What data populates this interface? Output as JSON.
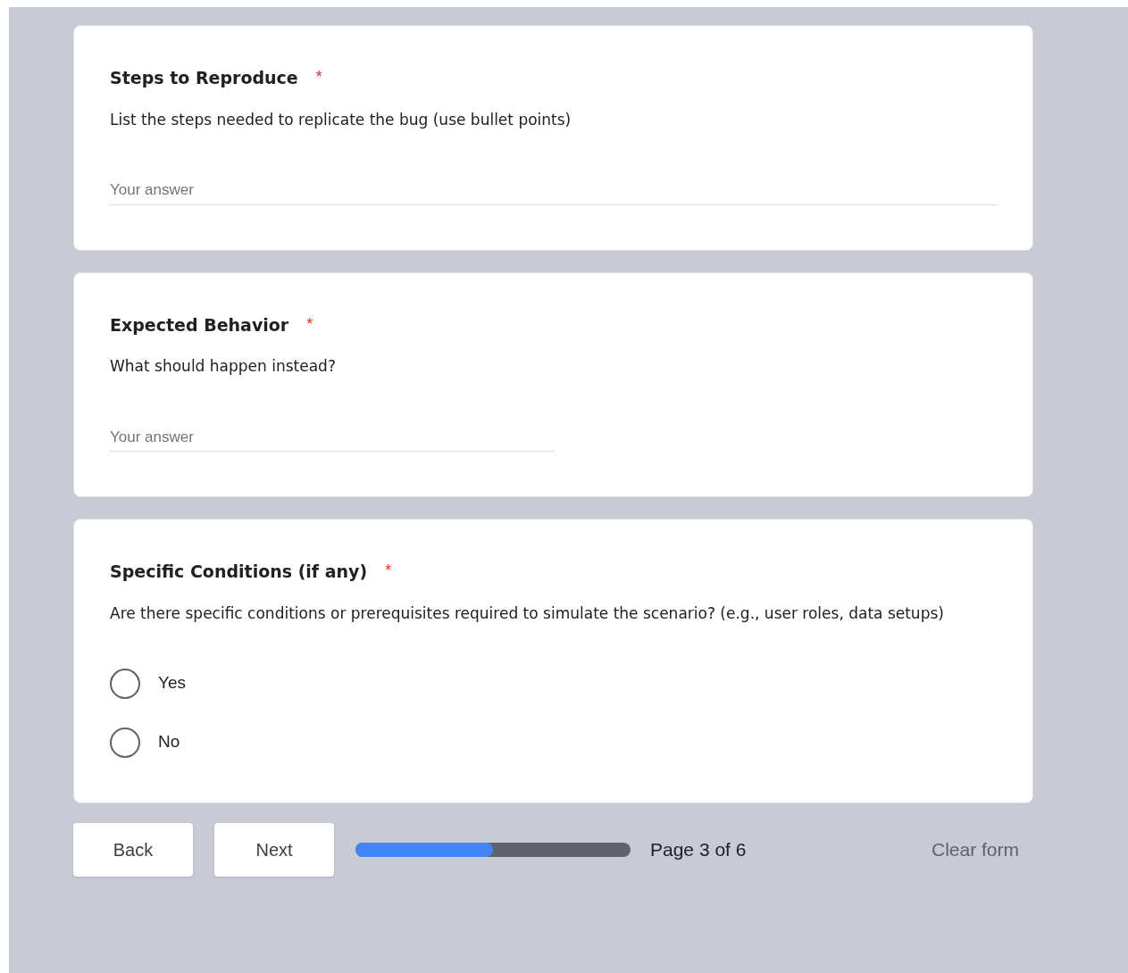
{
  "questions": [
    {
      "kind": "text",
      "title": "Steps to Reproduce",
      "required_mark": "*",
      "description": "List the steps needed to replicate the bug (use bullet points)",
      "placeholder": "Your answer",
      "wide": true
    },
    {
      "kind": "text",
      "title": "Expected Behavior",
      "required_mark": "*",
      "description": "What should happen instead?",
      "placeholder": "Your answer",
      "wide": false
    },
    {
      "kind": "radio",
      "title": "Specific Conditions (if any)",
      "required_mark": "*",
      "description": "Are there specific conditions or prerequisites required to simulate the scenario? (e.g., user roles, data setups)",
      "options": [
        {
          "label": "Yes",
          "selected": false
        },
        {
          "label": "No",
          "selected": false
        }
      ]
    }
  ],
  "footer": {
    "back": "Back",
    "next": "Next",
    "progress": {
      "level": 0.5
    },
    "page_label": "Page 3 of 6",
    "clear": "Clear form"
  }
}
